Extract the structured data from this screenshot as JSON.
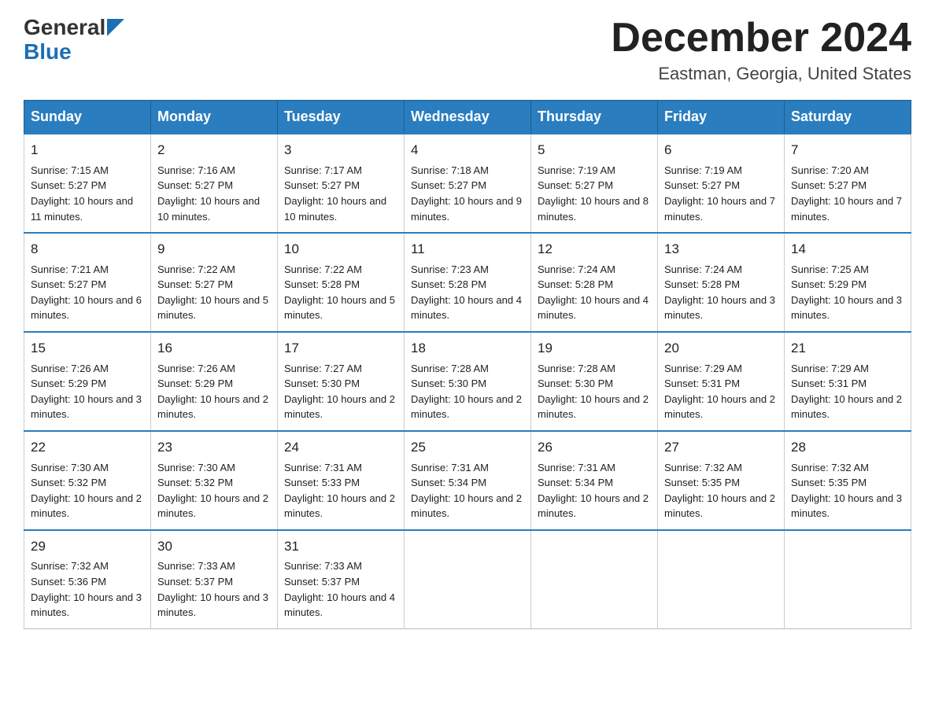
{
  "header": {
    "logo_general": "General",
    "logo_blue": "Blue",
    "title": "December 2024",
    "subtitle": "Eastman, Georgia, United States"
  },
  "days_of_week": [
    "Sunday",
    "Monday",
    "Tuesday",
    "Wednesday",
    "Thursday",
    "Friday",
    "Saturday"
  ],
  "weeks": [
    [
      {
        "day": "1",
        "sunrise": "7:15 AM",
        "sunset": "5:27 PM",
        "daylight": "10 hours and 11 minutes."
      },
      {
        "day": "2",
        "sunrise": "7:16 AM",
        "sunset": "5:27 PM",
        "daylight": "10 hours and 10 minutes."
      },
      {
        "day": "3",
        "sunrise": "7:17 AM",
        "sunset": "5:27 PM",
        "daylight": "10 hours and 10 minutes."
      },
      {
        "day": "4",
        "sunrise": "7:18 AM",
        "sunset": "5:27 PM",
        "daylight": "10 hours and 9 minutes."
      },
      {
        "day": "5",
        "sunrise": "7:19 AM",
        "sunset": "5:27 PM",
        "daylight": "10 hours and 8 minutes."
      },
      {
        "day": "6",
        "sunrise": "7:19 AM",
        "sunset": "5:27 PM",
        "daylight": "10 hours and 7 minutes."
      },
      {
        "day": "7",
        "sunrise": "7:20 AM",
        "sunset": "5:27 PM",
        "daylight": "10 hours and 7 minutes."
      }
    ],
    [
      {
        "day": "8",
        "sunrise": "7:21 AM",
        "sunset": "5:27 PM",
        "daylight": "10 hours and 6 minutes."
      },
      {
        "day": "9",
        "sunrise": "7:22 AM",
        "sunset": "5:27 PM",
        "daylight": "10 hours and 5 minutes."
      },
      {
        "day": "10",
        "sunrise": "7:22 AM",
        "sunset": "5:28 PM",
        "daylight": "10 hours and 5 minutes."
      },
      {
        "day": "11",
        "sunrise": "7:23 AM",
        "sunset": "5:28 PM",
        "daylight": "10 hours and 4 minutes."
      },
      {
        "day": "12",
        "sunrise": "7:24 AM",
        "sunset": "5:28 PM",
        "daylight": "10 hours and 4 minutes."
      },
      {
        "day": "13",
        "sunrise": "7:24 AM",
        "sunset": "5:28 PM",
        "daylight": "10 hours and 3 minutes."
      },
      {
        "day": "14",
        "sunrise": "7:25 AM",
        "sunset": "5:29 PM",
        "daylight": "10 hours and 3 minutes."
      }
    ],
    [
      {
        "day": "15",
        "sunrise": "7:26 AM",
        "sunset": "5:29 PM",
        "daylight": "10 hours and 3 minutes."
      },
      {
        "day": "16",
        "sunrise": "7:26 AM",
        "sunset": "5:29 PM",
        "daylight": "10 hours and 2 minutes."
      },
      {
        "day": "17",
        "sunrise": "7:27 AM",
        "sunset": "5:30 PM",
        "daylight": "10 hours and 2 minutes."
      },
      {
        "day": "18",
        "sunrise": "7:28 AM",
        "sunset": "5:30 PM",
        "daylight": "10 hours and 2 minutes."
      },
      {
        "day": "19",
        "sunrise": "7:28 AM",
        "sunset": "5:30 PM",
        "daylight": "10 hours and 2 minutes."
      },
      {
        "day": "20",
        "sunrise": "7:29 AM",
        "sunset": "5:31 PM",
        "daylight": "10 hours and 2 minutes."
      },
      {
        "day": "21",
        "sunrise": "7:29 AM",
        "sunset": "5:31 PM",
        "daylight": "10 hours and 2 minutes."
      }
    ],
    [
      {
        "day": "22",
        "sunrise": "7:30 AM",
        "sunset": "5:32 PM",
        "daylight": "10 hours and 2 minutes."
      },
      {
        "day": "23",
        "sunrise": "7:30 AM",
        "sunset": "5:32 PM",
        "daylight": "10 hours and 2 minutes."
      },
      {
        "day": "24",
        "sunrise": "7:31 AM",
        "sunset": "5:33 PM",
        "daylight": "10 hours and 2 minutes."
      },
      {
        "day": "25",
        "sunrise": "7:31 AM",
        "sunset": "5:34 PM",
        "daylight": "10 hours and 2 minutes."
      },
      {
        "day": "26",
        "sunrise": "7:31 AM",
        "sunset": "5:34 PM",
        "daylight": "10 hours and 2 minutes."
      },
      {
        "day": "27",
        "sunrise": "7:32 AM",
        "sunset": "5:35 PM",
        "daylight": "10 hours and 2 minutes."
      },
      {
        "day": "28",
        "sunrise": "7:32 AM",
        "sunset": "5:35 PM",
        "daylight": "10 hours and 3 minutes."
      }
    ],
    [
      {
        "day": "29",
        "sunrise": "7:32 AM",
        "sunset": "5:36 PM",
        "daylight": "10 hours and 3 minutes."
      },
      {
        "day": "30",
        "sunrise": "7:33 AM",
        "sunset": "5:37 PM",
        "daylight": "10 hours and 3 minutes."
      },
      {
        "day": "31",
        "sunrise": "7:33 AM",
        "sunset": "5:37 PM",
        "daylight": "10 hours and 4 minutes."
      },
      {
        "day": "",
        "sunrise": "",
        "sunset": "",
        "daylight": ""
      },
      {
        "day": "",
        "sunrise": "",
        "sunset": "",
        "daylight": ""
      },
      {
        "day": "",
        "sunrise": "",
        "sunset": "",
        "daylight": ""
      },
      {
        "day": "",
        "sunrise": "",
        "sunset": "",
        "daylight": ""
      }
    ]
  ],
  "labels": {
    "sunrise": "Sunrise:",
    "sunset": "Sunset:",
    "daylight": "Daylight:"
  }
}
